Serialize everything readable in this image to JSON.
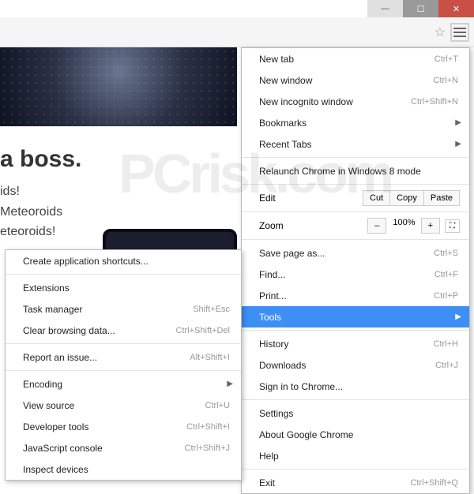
{
  "windowControls": {
    "min": "—",
    "max": "☐",
    "close": "✕"
  },
  "toolbar": {
    "star": "☆"
  },
  "page": {
    "headline": "a boss.",
    "lines": [
      "ids!",
      "Meteoroids",
      "eteoroids!"
    ]
  },
  "watermark": "PCrisk.com",
  "mainMenu": {
    "newTab": {
      "label": "New tab",
      "shortcut": "Ctrl+T"
    },
    "newWindow": {
      "label": "New window",
      "shortcut": "Ctrl+N"
    },
    "newIncognito": {
      "label": "New incognito window",
      "shortcut": "Ctrl+Shift+N"
    },
    "bookmarks": {
      "label": "Bookmarks"
    },
    "recentTabs": {
      "label": "Recent Tabs"
    },
    "relaunch": {
      "label": "Relaunch Chrome in Windows 8 mode"
    },
    "edit": {
      "label": "Edit",
      "cut": "Cut",
      "copy": "Copy",
      "paste": "Paste"
    },
    "zoom": {
      "label": "Zoom",
      "minus": "–",
      "value": "100%",
      "plus": "+",
      "fullscreen": "⛶"
    },
    "savePage": {
      "label": "Save page as...",
      "shortcut": "Ctrl+S"
    },
    "find": {
      "label": "Find...",
      "shortcut": "Ctrl+F"
    },
    "print": {
      "label": "Print...",
      "shortcut": "Ctrl+P"
    },
    "tools": {
      "label": "Tools"
    },
    "history": {
      "label": "History",
      "shortcut": "Ctrl+H"
    },
    "downloads": {
      "label": "Downloads",
      "shortcut": "Ctrl+J"
    },
    "signIn": {
      "label": "Sign in to Chrome..."
    },
    "settings": {
      "label": "Settings"
    },
    "about": {
      "label": "About Google Chrome"
    },
    "help": {
      "label": "Help"
    },
    "exit": {
      "label": "Exit",
      "shortcut": "Ctrl+Shift+Q"
    }
  },
  "subMenu": {
    "createShortcuts": {
      "label": "Create application shortcuts..."
    },
    "extensions": {
      "label": "Extensions"
    },
    "taskManager": {
      "label": "Task manager",
      "shortcut": "Shift+Esc"
    },
    "clearBrowsing": {
      "label": "Clear browsing data...",
      "shortcut": "Ctrl+Shift+Del"
    },
    "reportIssue": {
      "label": "Report an issue...",
      "shortcut": "Alt+Shift+I"
    },
    "encoding": {
      "label": "Encoding"
    },
    "viewSource": {
      "label": "View source",
      "shortcut": "Ctrl+U"
    },
    "devTools": {
      "label": "Developer tools",
      "shortcut": "Ctrl+Shift+I"
    },
    "jsConsole": {
      "label": "JavaScript console",
      "shortcut": "Ctrl+Shift+J"
    },
    "inspectDevices": {
      "label": "Inspect devices"
    }
  }
}
